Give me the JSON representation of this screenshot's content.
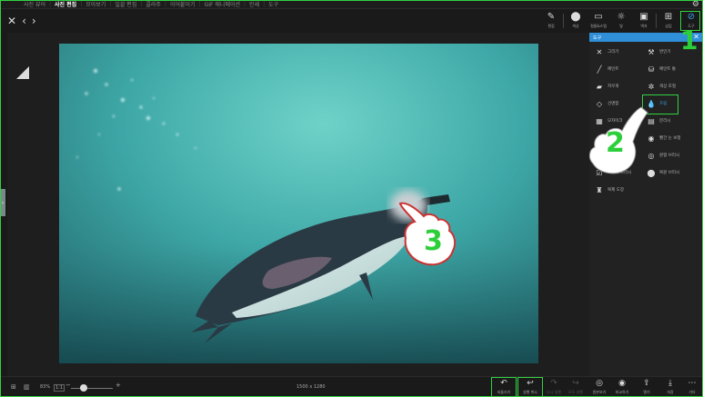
{
  "menu": {
    "items": [
      {
        "label": "사진 뷰어",
        "active": false
      },
      {
        "label": "사진 편집",
        "active": true
      },
      {
        "label": "모아보기",
        "active": false
      },
      {
        "label": "일괄 편집",
        "active": false
      },
      {
        "label": "콜라주",
        "active": false
      },
      {
        "label": "이어붙이기",
        "active": false
      },
      {
        "label": "GIF 애니메이션",
        "active": false
      },
      {
        "label": "인쇄",
        "active": false
      },
      {
        "label": "도구",
        "active": false
      }
    ]
  },
  "toolbar": {
    "edit_label": "편집",
    "adjust_label": "색상",
    "style_label": "필름&스탬",
    "light_label": "빛",
    "frame_label": "액자",
    "insert_label": "삽입",
    "tools_label": "도구"
  },
  "panel": {
    "title": "도구",
    "tools": [
      {
        "label": "그리기",
        "icon": "pencil-cross"
      },
      {
        "label": "번인기",
        "icon": "stamp-brush"
      },
      {
        "label": "페인트",
        "icon": "brush"
      },
      {
        "label": "페인트 통",
        "icon": "paint-bucket"
      },
      {
        "label": "지우개",
        "icon": "eraser"
      },
      {
        "label": "색상 조절",
        "icon": "sparkle"
      },
      {
        "label": "선명함",
        "icon": "diamond"
      },
      {
        "label": "흐림",
        "icon": "drop"
      },
      {
        "label": "모자이크",
        "icon": "mosaic"
      },
      {
        "label": "분리시",
        "icon": "sharpen"
      },
      {
        "label": "",
        "icon": "blank"
      },
      {
        "label": "빨간 눈 보정",
        "icon": "eye"
      },
      {
        "label": "",
        "icon": "blank"
      },
      {
        "label": "원형 브러시",
        "icon": "circle-brush"
      },
      {
        "label": "브러시 브러시",
        "icon": "check-brush"
      },
      {
        "label": "복원 브러시",
        "icon": "restore-drop"
      },
      {
        "label": "복제 도장",
        "icon": "clone-stamp"
      }
    ]
  },
  "bottom": {
    "zoom": "83%",
    "fit_label": "1:1",
    "dims": "1500 x 1280",
    "undo_label": "되돌리기",
    "cancel_label": "실행 취소",
    "redo_label": "다시 실행",
    "redo_all_label": "모두 실행",
    "compare_label": "원본보기",
    "compare2_label": "비교하기",
    "share_label": "열기",
    "save_label": "저장",
    "more_label": "기타"
  },
  "annotations": {
    "step1": "1",
    "step2": "2",
    "step3": "3"
  },
  "colors": {
    "accent": "#2f8fd8",
    "highlight": "#32d240"
  }
}
